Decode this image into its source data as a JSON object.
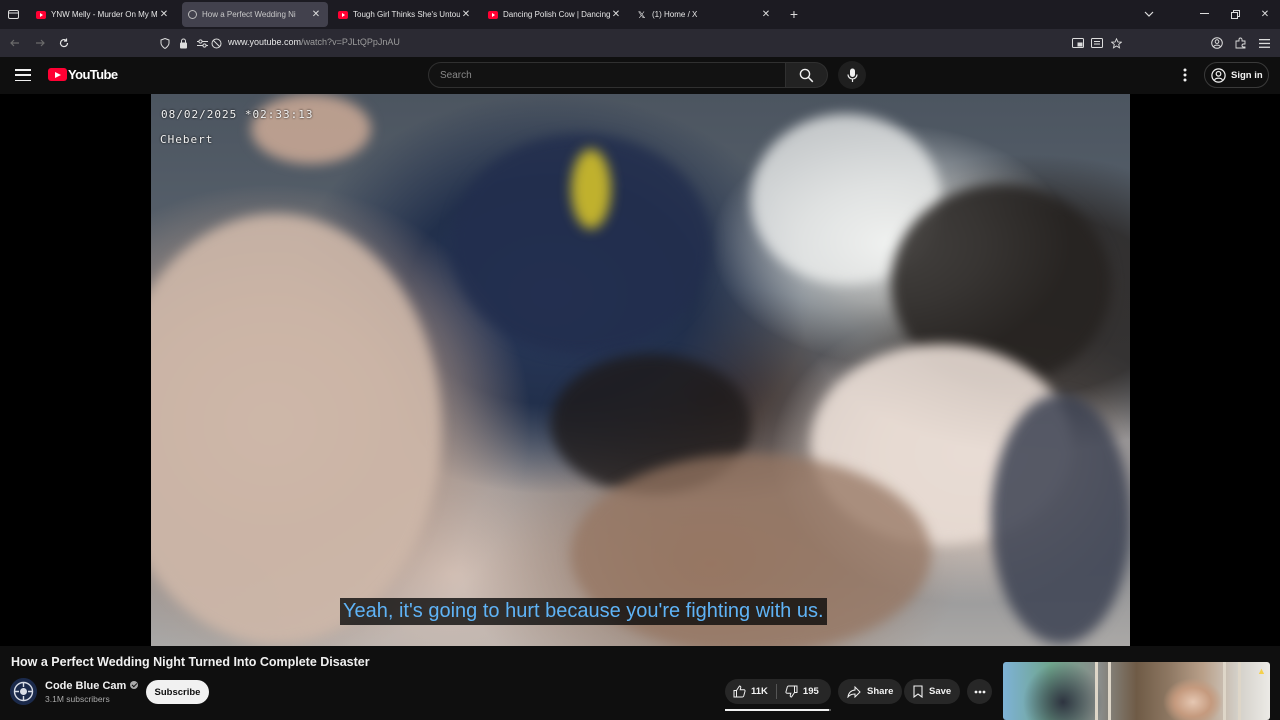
{
  "browser": {
    "tabs": [
      {
        "title": "YNW Melly - Murder On My Mi",
        "favicon": "youtube-icon",
        "active": false
      },
      {
        "title": "How a Perfect Wedding Ni",
        "favicon": "audio-playing-icon",
        "active": true
      },
      {
        "title": "Tough Girl Thinks She's Untouc",
        "favicon": "youtube-icon",
        "active": false
      },
      {
        "title": "Dancing Polish Cow | Dancing",
        "favicon": "youtube-icon",
        "active": false
      },
      {
        "title": "(1) Home / X",
        "favicon": "x-icon",
        "active": false
      }
    ],
    "url_host": "www.youtube.com",
    "url_path": "/watch?v=PJLtQPpJnAU"
  },
  "youtube": {
    "logo_text": "YouTube",
    "search_placeholder": "Search",
    "sign_in_label": "Sign in"
  },
  "video": {
    "osd_datetime": "08/02/2025 *02:33:13",
    "osd_officer": "CHebert",
    "caption": "Yeah, it's going to hurt because you're fighting with us.",
    "title": "How a Perfect Wedding Night Turned Into Complete Disaster",
    "channel": {
      "name": "Code Blue Cam",
      "verified": true,
      "subscribers": "3.1M subscribers",
      "subscribe_label": "Subscribe"
    },
    "actions": {
      "likes": "11K",
      "dislikes": "195",
      "like_ratio": 0.98,
      "share_label": "Share",
      "save_label": "Save"
    }
  },
  "colors": {
    "caption_text": "#5fb3f6",
    "brand_red": "#ff0033",
    "background": "#0f0f0f"
  }
}
